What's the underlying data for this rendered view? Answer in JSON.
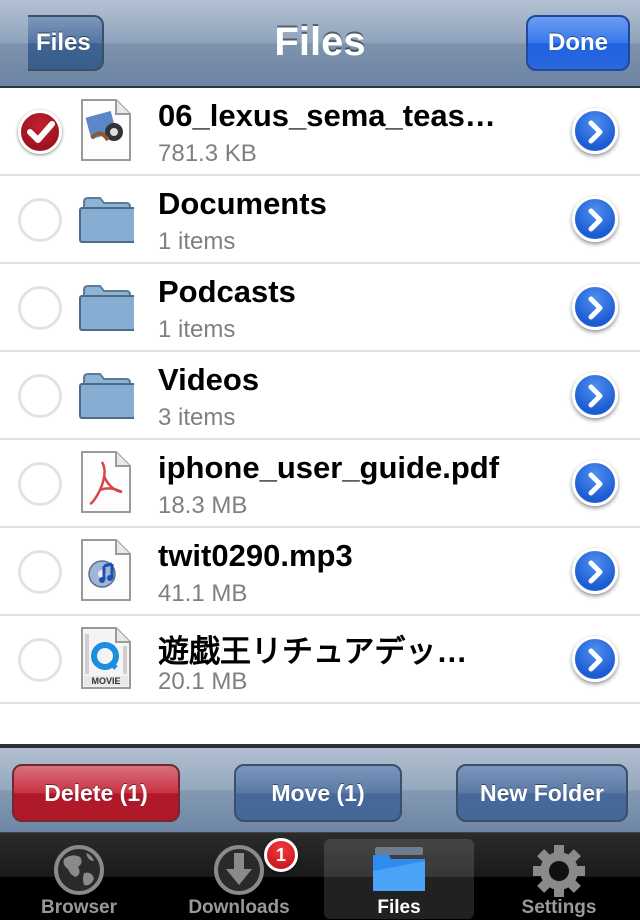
{
  "navbar": {
    "title": "Files",
    "back_label": "Files",
    "done_label": "Done"
  },
  "files": [
    {
      "name": "06_lexus_sema_teas…",
      "meta": "781.3 KB",
      "type": "video-file",
      "selected": true
    },
    {
      "name": "Documents",
      "meta": "1 items",
      "type": "folder",
      "selected": false
    },
    {
      "name": "Podcasts",
      "meta": "1 items",
      "type": "folder",
      "selected": false
    },
    {
      "name": "Videos",
      "meta": "3 items",
      "type": "folder",
      "selected": false
    },
    {
      "name": "iphone_user_guide.pdf",
      "meta": "18.3 MB",
      "type": "pdf-file",
      "selected": false
    },
    {
      "name": "twit0290.mp3",
      "meta": "41.1 MB",
      "type": "audio-file",
      "selected": false
    },
    {
      "name": "遊戯王リチュアデッ…",
      "meta": "20.1 MB",
      "type": "movie-file",
      "selected": false
    }
  ],
  "toolbar": {
    "delete_label": "Delete (1)",
    "move_label": "Move (1)",
    "new_folder_label": "New Folder"
  },
  "tabs": [
    {
      "label": "Browser",
      "icon": "globe-icon",
      "active": false
    },
    {
      "label": "Downloads",
      "icon": "download-icon",
      "active": false,
      "badge": "1"
    },
    {
      "label": "Files",
      "icon": "folder-icon",
      "active": true
    },
    {
      "label": "Settings",
      "icon": "gear-icon",
      "active": false
    }
  ],
  "colors": {
    "accent_blue": "#2a67de",
    "delete_red": "#b1182a",
    "badge_red": "#c40d12"
  }
}
